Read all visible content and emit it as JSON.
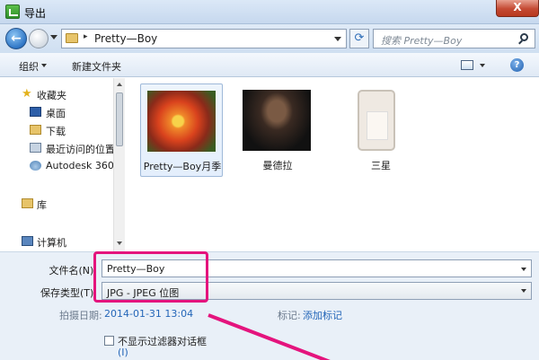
{
  "window": {
    "title": "导出",
    "close_glyph": "X"
  },
  "address_bar": {
    "path_separator": "▸",
    "path": "Pretty—Boy",
    "back_glyph": "←",
    "refresh_glyph": "⟳"
  },
  "search": {
    "placeholder": "搜索 Pretty—Boy"
  },
  "toolbar": {
    "organize_label": "组织",
    "new_folder_label": "新建文件夹",
    "help_glyph": "?"
  },
  "navigation": {
    "items": [
      {
        "label": "收藏夹",
        "icon": "star-icon"
      },
      {
        "label": "桌面",
        "icon": "desktop-icon"
      },
      {
        "label": "下载",
        "icon": "downloads-icon"
      },
      {
        "label": "最近访问的位置",
        "icon": "recent-places-icon"
      },
      {
        "label": "Autodesk 360",
        "icon": "cloud-icon"
      },
      {
        "label": "库",
        "icon": "library-icon"
      },
      {
        "label": "计算机",
        "icon": "computer-icon"
      }
    ]
  },
  "files": [
    {
      "name": "Pretty—Boy月季",
      "selected": true
    },
    {
      "name": "曼德拉",
      "selected": false
    },
    {
      "name": "三星",
      "selected": false
    }
  ],
  "form": {
    "filename_label": "文件名(N):",
    "filename_value": "Pretty—Boy",
    "filetype_label": "保存类型(T):",
    "filetype_value": "JPG - JPEG 位图",
    "date_label": "拍摄日期:",
    "date_value": "2014-01-31 13:04",
    "tags_label": "标记:",
    "tags_value": "添加标记",
    "checkbox_label": "不显示过滤器对话框",
    "checkbox_suffix": "(I)"
  },
  "annotation_color": "#e4147d"
}
